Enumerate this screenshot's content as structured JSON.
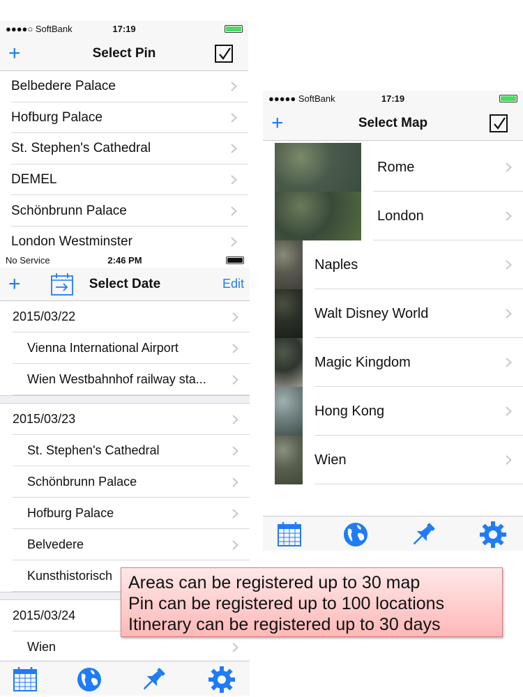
{
  "pin_screen": {
    "status": {
      "carrier": "●●●●○ SoftBank",
      "time": "17:19"
    },
    "nav": {
      "add": "+",
      "title": "Select Pin"
    },
    "rows": [
      "Belbedere Palace",
      "Hofburg Palace",
      "St. Stephen's Cathedral",
      "DEMEL",
      "Schönbrunn Palace",
      "London Westminster"
    ]
  },
  "map_screen": {
    "status": {
      "carrier": "●●●●● SoftBank",
      "time": "17:19"
    },
    "nav": {
      "add": "+",
      "title": "Select Map"
    },
    "rows": [
      "Rome",
      "London",
      "Naples",
      "Walt Disney World",
      "Magic Kingdom",
      "Hong Kong",
      "Wien"
    ],
    "tabs": [
      "calendar-icon",
      "globe-icon",
      "pin-icon",
      "gear-icon"
    ]
  },
  "date_screen": {
    "status": {
      "carrier": "No Service",
      "time": "2:46 PM"
    },
    "nav": {
      "add": "+",
      "title": "Select Date",
      "edit": "Edit"
    },
    "sections": [
      {
        "date": "2015/03/22",
        "items": [
          "Vienna International Airport",
          "Wien Westbahnhof railway sta..."
        ]
      },
      {
        "date": "2015/03/23",
        "items": [
          "St. Stephen's Cathedral",
          "Schönbrunn Palace",
          "Hofburg Palace",
          "Belvedere",
          "Kunsthistorisch"
        ]
      },
      {
        "date": "2015/03/24",
        "items": [
          "Wien"
        ]
      }
    ],
    "tabs": [
      "calendar-icon",
      "globe-icon",
      "pin-icon",
      "gear-icon"
    ]
  },
  "callout": {
    "lines": [
      "Areas can be registered up to 30 map",
      "Pin can be registered up to 100 locations",
      "Itinerary can be registered up to 30 days"
    ]
  },
  "colors": {
    "accent": "#1f7cf5",
    "battery_green": "#4cd964",
    "callout_bg": "#ffc8c8"
  }
}
